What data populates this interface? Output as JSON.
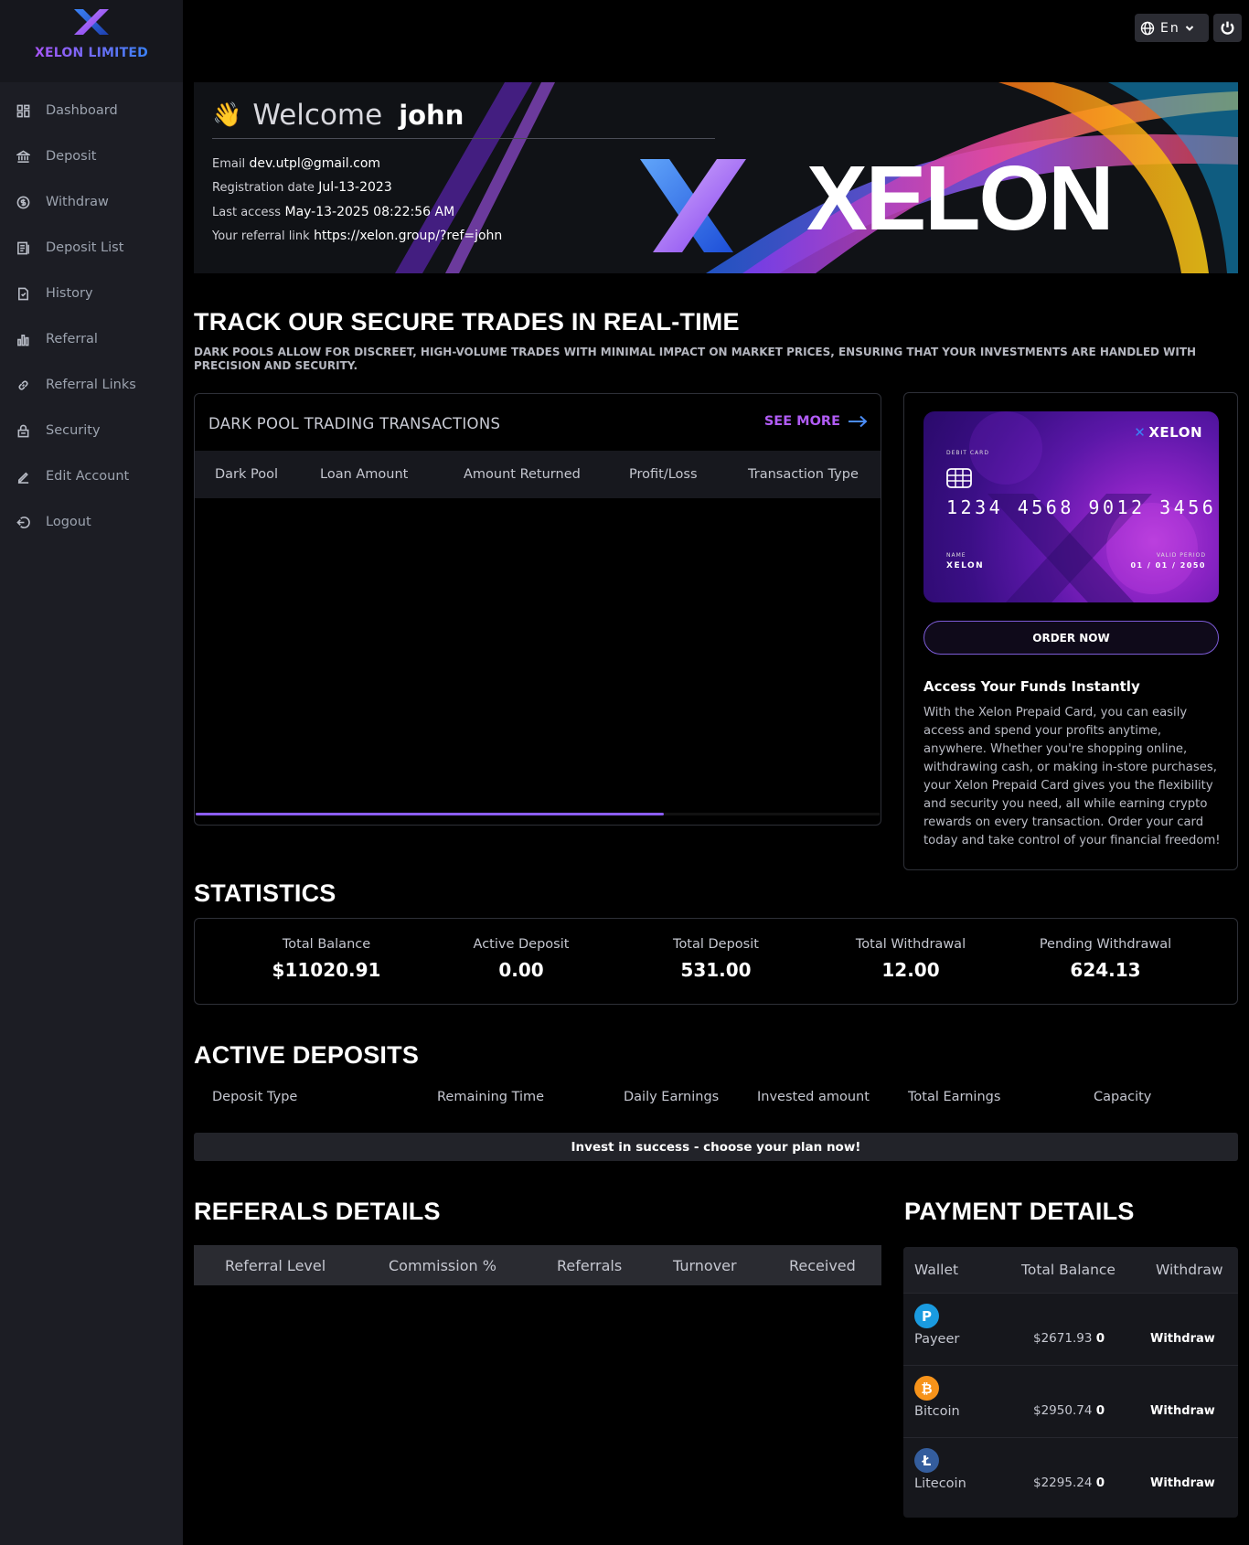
{
  "brand": {
    "name": "XELON LIMITED"
  },
  "sidebar": {
    "items": [
      {
        "label": "Dashboard",
        "icon": "dashboard-icon"
      },
      {
        "label": "Deposit",
        "icon": "bank-icon"
      },
      {
        "label": "Withdraw",
        "icon": "coin-icon"
      },
      {
        "label": "Deposit List",
        "icon": "list-icon"
      },
      {
        "label": "History",
        "icon": "document-icon"
      },
      {
        "label": "Referral",
        "icon": "bar-chart-icon"
      },
      {
        "label": "Referral Links",
        "icon": "link-icon"
      },
      {
        "label": "Security",
        "icon": "lock-icon"
      },
      {
        "label": "Edit Account",
        "icon": "edit-icon"
      },
      {
        "label": "Logout",
        "icon": "logout-icon"
      }
    ]
  },
  "topbar": {
    "language": "En"
  },
  "banner": {
    "welcome_word": "Welcome",
    "user_name": "john",
    "email_label": "Email",
    "email": "dev.utpl@gmail.com",
    "registration_label": "Registration date",
    "registration_date": "Jul-13-2023",
    "last_access_label": "Last access",
    "last_access": "May-13-2025 08:22:56 AM",
    "referral_label": "Your referral link",
    "referral_link": "https://xelon.group/?ref=john",
    "brand_word": "XELON"
  },
  "trades": {
    "heading": "TRACK OUR SECURE TRADES IN REAL-TIME",
    "subheading": "DARK POOLS ALLOW FOR DISCREET, HIGH-VOLUME TRADES WITH MINIMAL IMPACT ON MARKET PRICES, ENSURING THAT YOUR INVESTMENTS ARE HANDLED WITH PRECISION AND SECURITY.",
    "panel_title": "DARK POOL TRADING TRANSACTIONS",
    "see_more": "SEE MORE",
    "columns": [
      "Dark Pool",
      "Loan Amount",
      "Amount Returned",
      "Profit/Loss",
      "Transaction Type"
    ]
  },
  "card": {
    "logo": "XELON",
    "debit_label": "DEBIT CARD",
    "number": "1234 4568 9012 3456",
    "name_label": "NAME",
    "name": "XELON",
    "valid_label": "VALID PERIOD",
    "valid": "01 / 01 / 2050",
    "order_button": "ORDER NOW",
    "access_title": "Access Your Funds Instantly",
    "access_text": "With the Xelon Prepaid Card, you can easily access and spend your profits anytime, anywhere. Whether you're shopping online, withdrawing cash, or making in-store purchases, your Xelon Prepaid Card gives you the flexibility and security you need, all while earning crypto rewards on every transaction. Order your card today and take control of your financial freedom!"
  },
  "statistics": {
    "heading": "STATISTICS",
    "items": [
      {
        "label": "Total Balance",
        "value": "$11020.91"
      },
      {
        "label": "Active Deposit",
        "value": "0.00"
      },
      {
        "label": "Total Deposit",
        "value": "531.00"
      },
      {
        "label": "Total Withdrawal",
        "value": "12.00"
      },
      {
        "label": "Pending Withdrawal",
        "value": "624.13"
      }
    ]
  },
  "active_deposits": {
    "heading": "ACTIVE DEPOSITS",
    "columns": [
      "Deposit Type",
      "Remaining Time",
      "Daily Earnings",
      "Invested amount",
      "Total Earnings",
      "Capacity"
    ],
    "empty_message": "Invest in success - choose your plan now!"
  },
  "referrals": {
    "heading": "REFERALS DETAILS",
    "columns": [
      "Referral Level",
      "Commission %",
      "Referrals",
      "Turnover",
      "Received"
    ]
  },
  "payment": {
    "heading": "PAYMENT DETAILS",
    "columns": [
      "Wallet",
      "Total Balance",
      "Withdraw"
    ],
    "rows": [
      {
        "name": "Payeer",
        "balance": "$2671.93",
        "pending": "0",
        "action": "Withdraw",
        "icon": "payeer-icon",
        "symbol": "P",
        "color": "#1a9be0"
      },
      {
        "name": "Bitcoin",
        "balance": "$2950.74",
        "pending": "0",
        "action": "Withdraw",
        "icon": "bitcoin-icon",
        "symbol": "₿",
        "color": "#f7931a"
      },
      {
        "name": "Litecoin",
        "balance": "$2295.24",
        "pending": "0",
        "action": "Withdraw",
        "icon": "litecoin-icon",
        "symbol": "Ł",
        "color": "#345d9d"
      }
    ]
  }
}
